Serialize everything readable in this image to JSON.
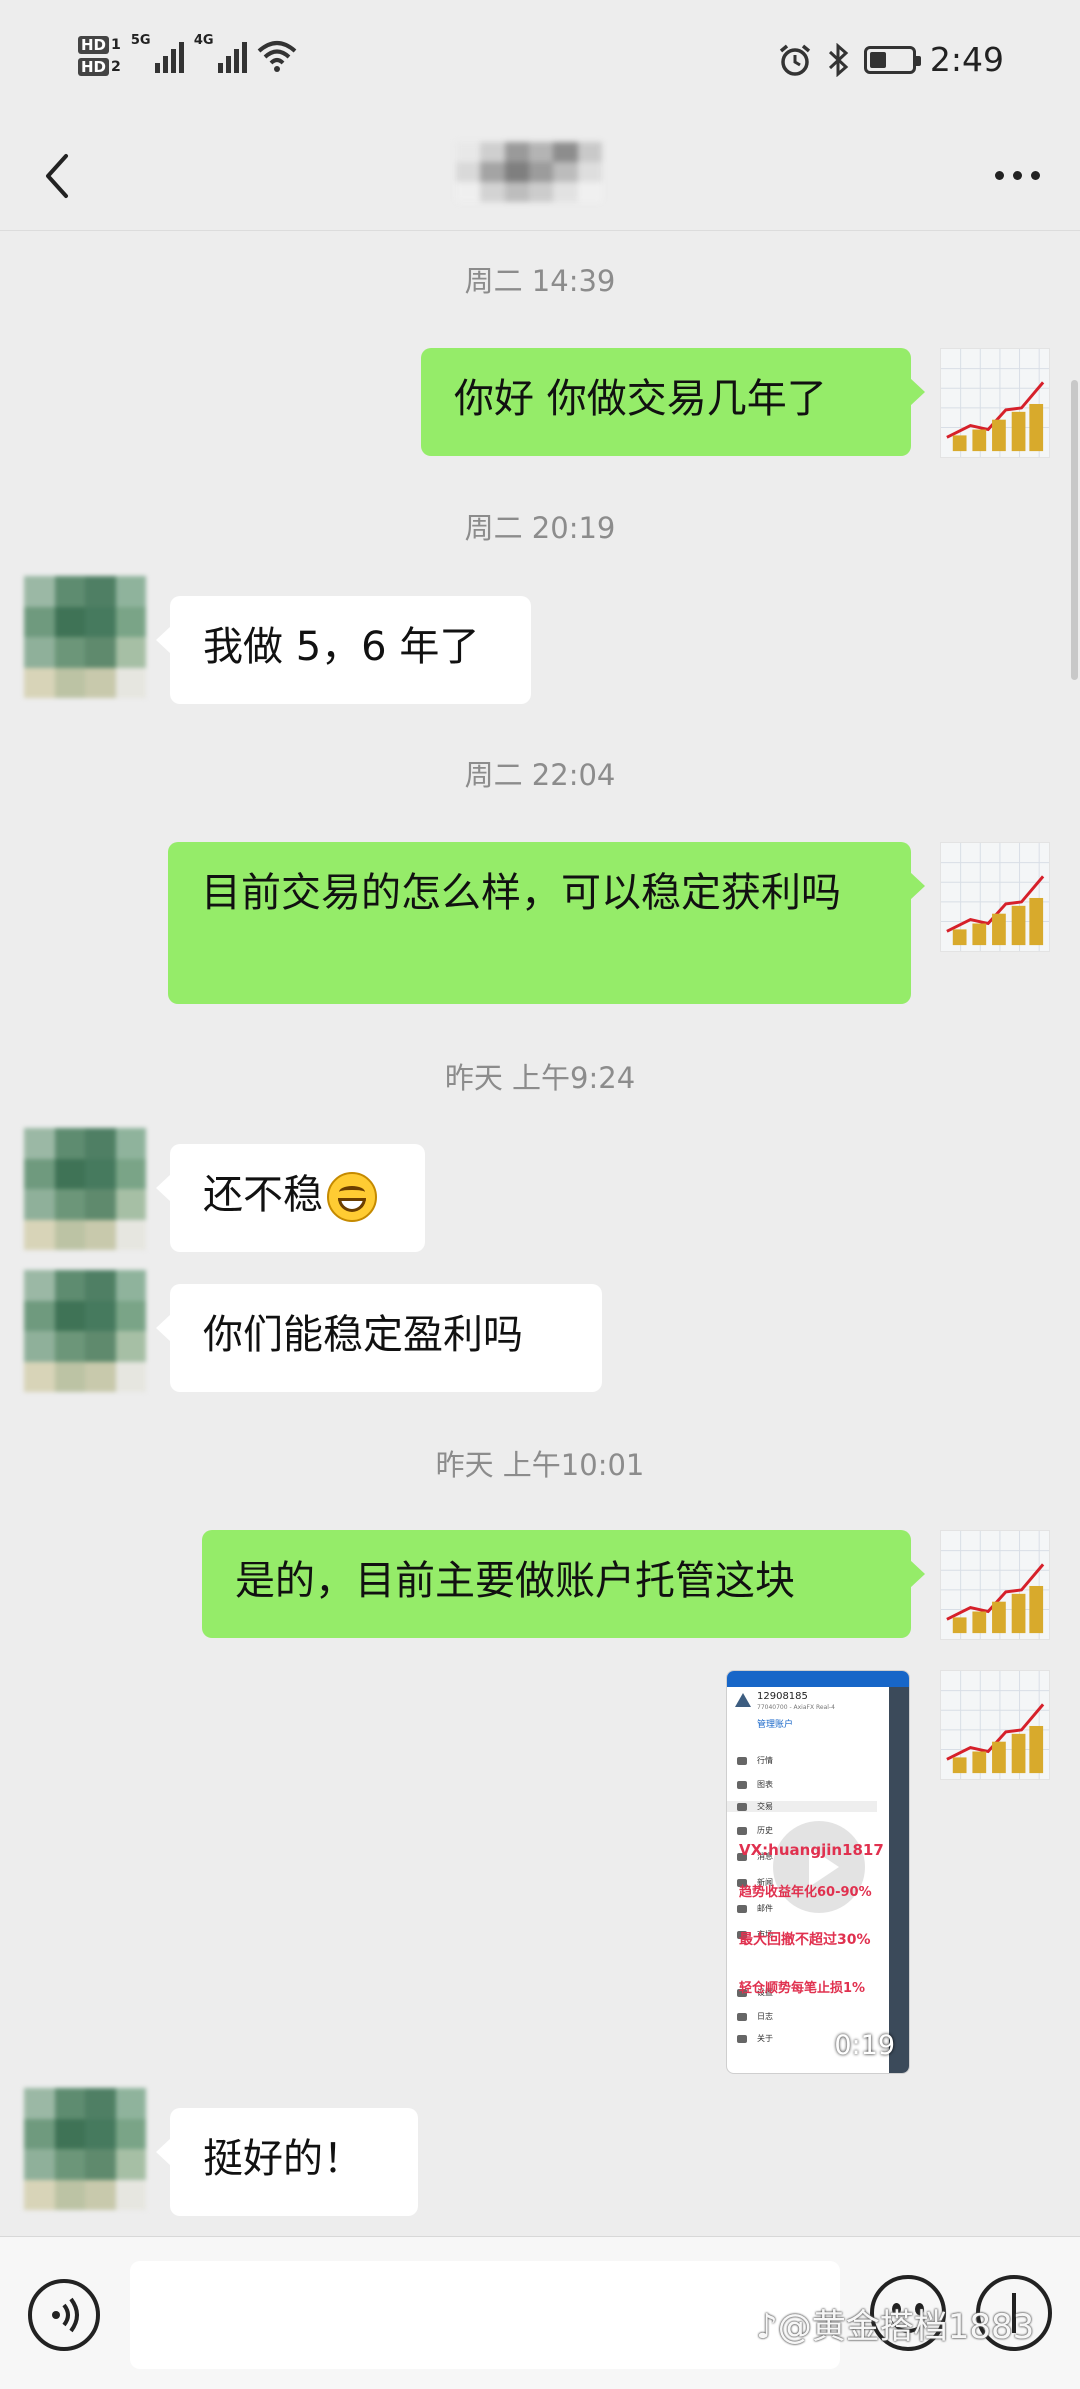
{
  "status_bar": {
    "hd1": "HD",
    "hd1_sub": "1",
    "hd2": "HD",
    "hd2_sub": "2",
    "net1": "5G",
    "net2": "4G",
    "time": "2:49"
  },
  "chat": {
    "messages": [
      {
        "time": "周二 14:39"
      },
      {
        "from": "me",
        "text": "你好 你做交易几年了"
      },
      {
        "time": "周二 20:19"
      },
      {
        "from": "them",
        "text": "我做 5，6 年了"
      },
      {
        "time": "周二 22:04"
      },
      {
        "from": "me",
        "text": "目前交易的怎么样，可以稳定获利吗"
      },
      {
        "time": "昨天 上午9:24"
      },
      {
        "from": "them",
        "text": "还不稳",
        "emoji": "grinning-face-emoji"
      },
      {
        "from": "them",
        "text": "你们能稳定盈利吗"
      },
      {
        "time": "昨天 上午10:01"
      },
      {
        "from": "me",
        "text": "是的，目前主要做账户托管这块"
      },
      {
        "from": "me",
        "type": "video",
        "duration": "0:19"
      },
      {
        "from": "them",
        "text": "挺好的！"
      }
    ]
  },
  "video": {
    "account_no": "12908185",
    "account_sub": "77040700 - AxiaFX Real-4",
    "manage": "管理账户",
    "menu": [
      "行情",
      "图表",
      "交易",
      "历史",
      "消息",
      "新闻",
      "邮件",
      "市场",
      "设置",
      "日志",
      "关于"
    ],
    "overlay_lines": [
      "VX:huangjin1817",
      "趋势收益年化60-90%",
      "最大回撤不超过30%",
      "轻仓顺势每笔止损1%"
    ]
  },
  "bottom_bar": {
    "watermark": "♪@黄金搭档1883"
  },
  "colors": {
    "background": "#ededed",
    "my_bubble": "#95ec69",
    "their_bubble": "#ffffff",
    "video_overlay_red": "#e0314f"
  },
  "icons": [
    "back-arrow-icon",
    "more-dots-icon",
    "voice-icon",
    "emoji-icon",
    "plus-icon",
    "play-icon",
    "alarm-icon",
    "bluetooth-icon",
    "battery-icon",
    "wifi-icon"
  ]
}
